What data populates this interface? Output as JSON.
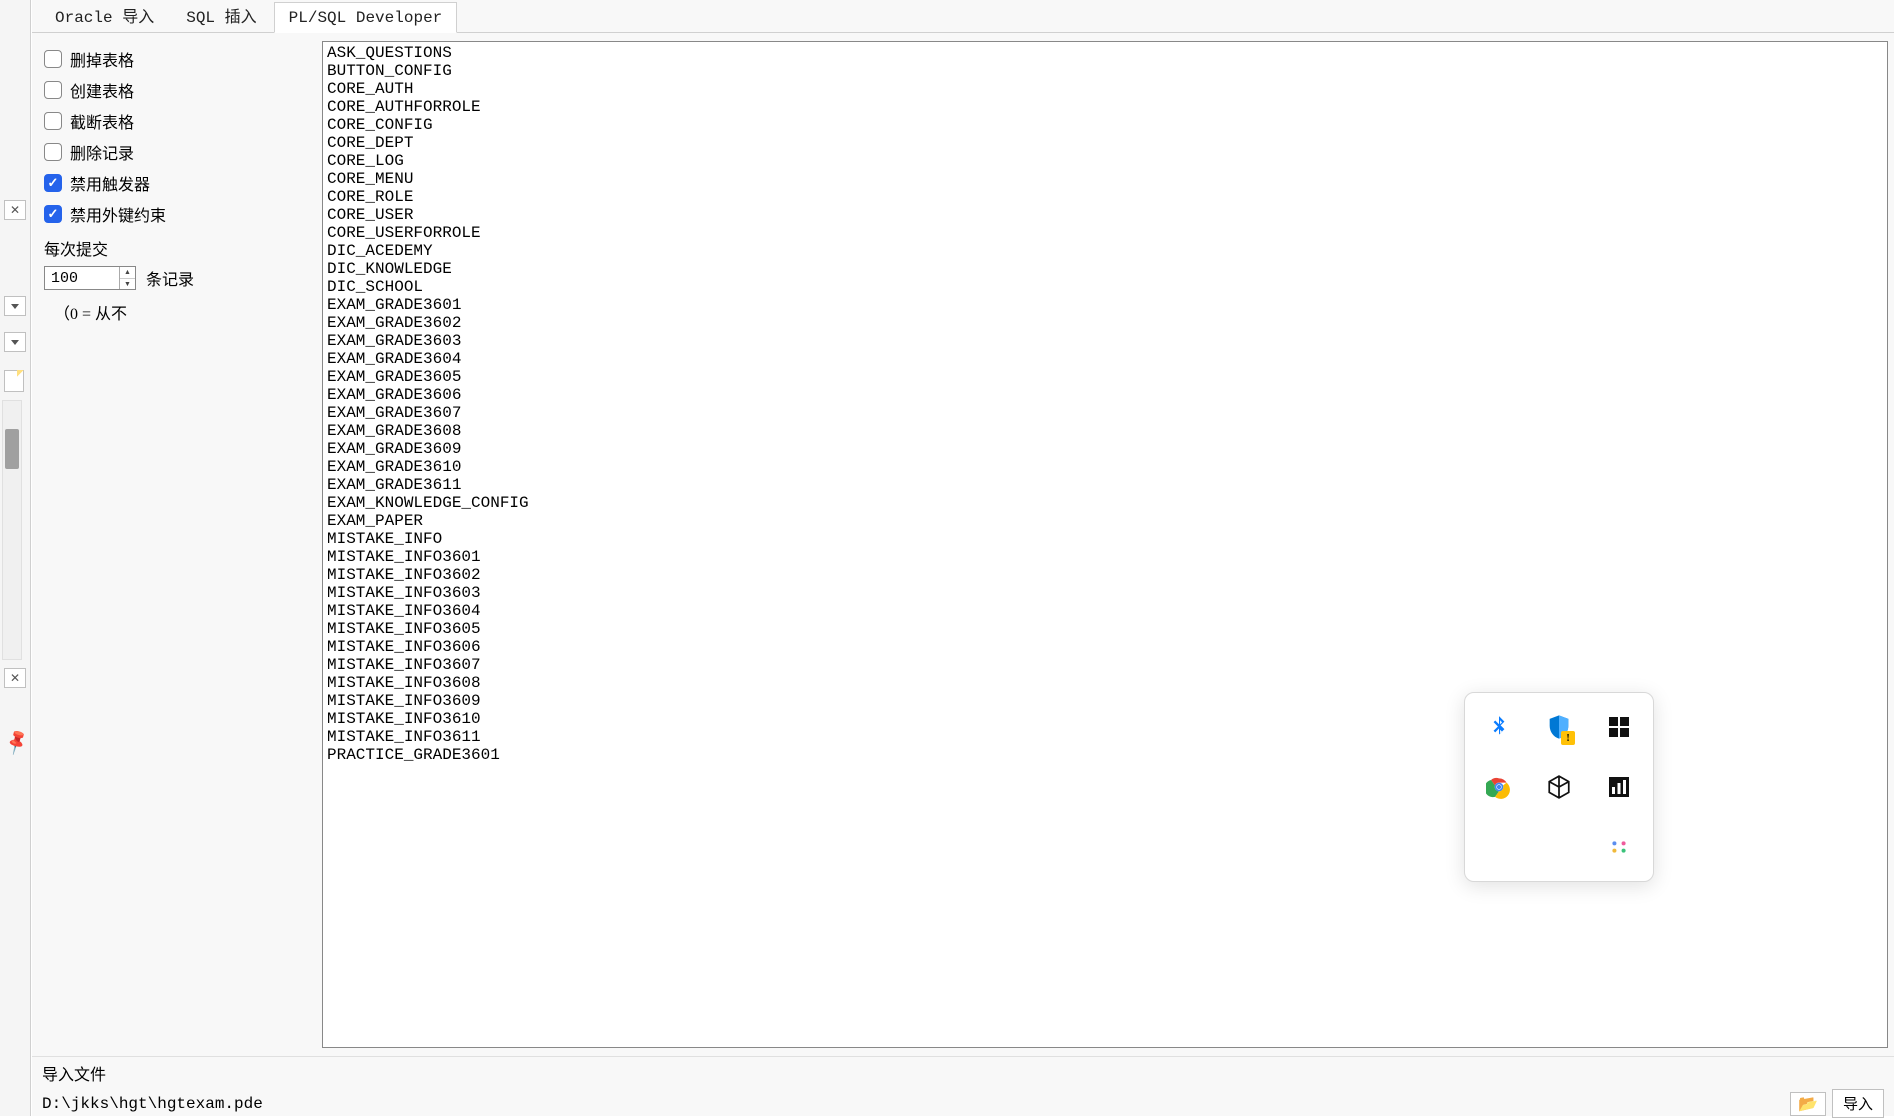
{
  "tabs": [
    {
      "label": "Oracle 导入"
    },
    {
      "label": "SQL 插入"
    },
    {
      "label": "PL/SQL Developer"
    }
  ],
  "active_tab_index": 2,
  "options": {
    "drop_tables": {
      "label": "删掉表格",
      "checked": false
    },
    "create_tables": {
      "label": "创建表格",
      "checked": false
    },
    "truncate_tables": {
      "label": "截断表格",
      "checked": false
    },
    "delete_records": {
      "label": "删除记录",
      "checked": false
    },
    "disable_triggers": {
      "label": "禁用触发器",
      "checked": true
    },
    "disable_fk": {
      "label": "禁用外键约束",
      "checked": true
    }
  },
  "commit": {
    "label": "每次提交",
    "value": "100",
    "records_label": "条记录",
    "zero_note": "（0 = 从不"
  },
  "tables": [
    "ASK_QUESTIONS",
    "BUTTON_CONFIG",
    "CORE_AUTH",
    "CORE_AUTHFORROLE",
    "CORE_CONFIG",
    "CORE_DEPT",
    "CORE_LOG",
    "CORE_MENU",
    "CORE_ROLE",
    "CORE_USER",
    "CORE_USERFORROLE",
    "DIC_ACEDEMY",
    "DIC_KNOWLEDGE",
    "DIC_SCHOOL",
    "EXAM_GRADE3601",
    "EXAM_GRADE3602",
    "EXAM_GRADE3603",
    "EXAM_GRADE3604",
    "EXAM_GRADE3605",
    "EXAM_GRADE3606",
    "EXAM_GRADE3607",
    "EXAM_GRADE3608",
    "EXAM_GRADE3609",
    "EXAM_GRADE3610",
    "EXAM_GRADE3611",
    "EXAM_KNOWLEDGE_CONFIG",
    "EXAM_PAPER",
    "MISTAKE_INFO",
    "MISTAKE_INFO3601",
    "MISTAKE_INFO3602",
    "MISTAKE_INFO3603",
    "MISTAKE_INFO3604",
    "MISTAKE_INFO3605",
    "MISTAKE_INFO3606",
    "MISTAKE_INFO3607",
    "MISTAKE_INFO3608",
    "MISTAKE_INFO3609",
    "MISTAKE_INFO3610",
    "MISTAKE_INFO3611",
    "PRACTICE_GRADE3601"
  ],
  "import": {
    "label": "导入文件",
    "path": "D:\\jkks\\hgt\\hgtexam.pde",
    "button": "导入"
  },
  "tray_icons": [
    "bluetooth-icon",
    "security-shield-icon",
    "dashboard-icon",
    "chrome-icon",
    "cube-3d-icon",
    "bar-chart-icon",
    "more-dots-icon"
  ]
}
